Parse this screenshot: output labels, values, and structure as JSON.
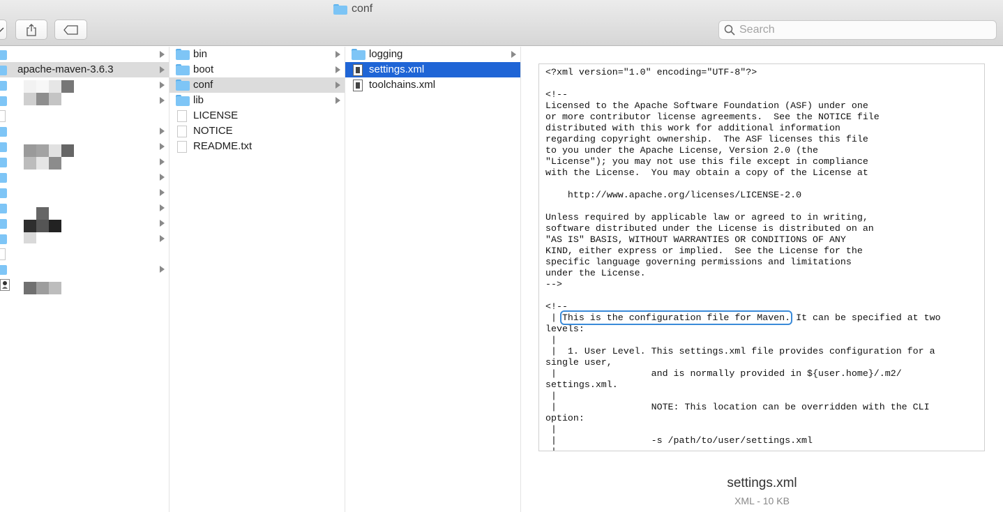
{
  "window": {
    "title": "conf"
  },
  "search": {
    "placeholder": "Search"
  },
  "column1": {
    "items": [
      {
        "label": ""
      },
      {
        "label": "apache-maven-3.6.3"
      }
    ]
  },
  "column2": {
    "items": [
      {
        "label": "bin",
        "type": "folder"
      },
      {
        "label": "boot",
        "type": "folder"
      },
      {
        "label": "conf",
        "type": "folder"
      },
      {
        "label": "lib",
        "type": "folder"
      },
      {
        "label": "LICENSE",
        "type": "file"
      },
      {
        "label": "NOTICE",
        "type": "file"
      },
      {
        "label": "README.txt",
        "type": "file"
      }
    ]
  },
  "column3": {
    "items": [
      {
        "label": "logging",
        "type": "folder"
      },
      {
        "label": "settings.xml",
        "type": "xml"
      },
      {
        "label": "toolchains.xml",
        "type": "xml"
      }
    ]
  },
  "preview": {
    "code_before": "<?xml version=\"1.0\" encoding=\"UTF-8\"?>\n\n<!--\nLicensed to the Apache Software Foundation (ASF) under one\nor more contributor license agreements.  See the NOTICE file\ndistributed with this work for additional information\nregarding copyright ownership.  The ASF licenses this file\nto you under the Apache License, Version 2.0 (the\n\"License\"); you may not use this file except in compliance\nwith the License.  You may obtain a copy of the License at\n\n    http://www.apache.org/licenses/LICENSE-2.0\n\nUnless required by applicable law or agreed to in writing,\nsoftware distributed under the License is distributed on an\n\"AS IS\" BASIS, WITHOUT WARRANTIES OR CONDITIONS OF ANY\nKIND, either express or implied.  See the License for the\nspecific language governing permissions and limitations\nunder the License.\n-->\n\n<!--\n | ",
    "code_highlight": "This is the configuration file for Maven.",
    "code_after": " It can be specified at two\nlevels:\n |\n |  1. User Level. This settings.xml file provides configuration for a\nsingle user,\n |                 and is normally provided in ${user.home}/.m2/\nsettings.xml.\n |\n |                 NOTE: This location can be overridden with the CLI\noption:\n |\n |                 -s /path/to/user/settings.xml\n |",
    "file_name": "settings.xml",
    "file_meta": "XML - 10 KB"
  },
  "colors": {
    "selection_blue": "#1f65d6",
    "selection_gray": "#dcdcdc",
    "folder": "#7ec5f6",
    "highlight_outline": "#3a8ad8"
  }
}
